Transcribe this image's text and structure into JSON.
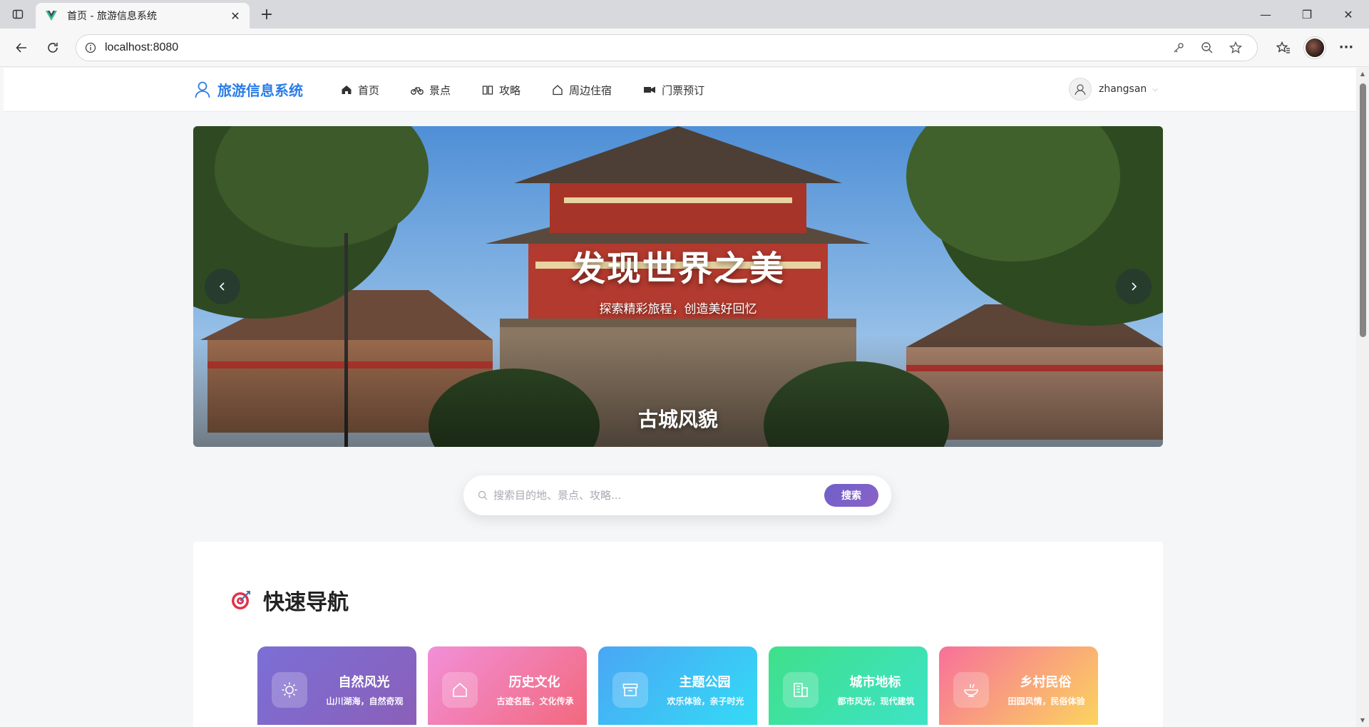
{
  "browser": {
    "tab_title": "首页 - 旅游信息系统",
    "url": "localhost:8080"
  },
  "header": {
    "brand": "旅游信息系统",
    "menu": [
      {
        "label": "首页",
        "icon": "home-icon"
      },
      {
        "label": "景点",
        "icon": "bicycle-icon"
      },
      {
        "label": "攻略",
        "icon": "book-icon"
      },
      {
        "label": "周边住宿",
        "icon": "house-icon"
      },
      {
        "label": "门票预订",
        "icon": "ticket-icon"
      }
    ],
    "username": "zhangsan"
  },
  "carousel": {
    "title": "发现世界之美",
    "subtitle": "探索精彩旅程，创造美好回忆",
    "caption": "古城风貌"
  },
  "search": {
    "placeholder": "搜索目的地、景点、攻略...",
    "button": "搜索"
  },
  "quick_nav": {
    "title": "快速导航",
    "items": [
      {
        "name": "自然风光",
        "desc": "山川湖海，自然奇观",
        "icon": "sun-icon",
        "colors": [
          "#7b6fd6",
          "#8a5fb8"
        ]
      },
      {
        "name": "历史文化",
        "desc": "古迹名胜，文化传承",
        "icon": "house-icon",
        "colors": [
          "#f28fd8",
          "#f2697d"
        ]
      },
      {
        "name": "主题公园",
        "desc": "欢乐体验，亲子时光",
        "icon": "box-icon",
        "colors": [
          "#4aa6f5",
          "#33dbf5"
        ]
      },
      {
        "name": "城市地标",
        "desc": "都市风光，现代建筑",
        "icon": "building-icon",
        "colors": [
          "#3fe08a",
          "#3ee3c6"
        ]
      },
      {
        "name": "乡村民俗",
        "desc": "田园风情，民俗体验",
        "icon": "bowl-icon",
        "colors": [
          "#f7709a",
          "#fbd45e"
        ]
      }
    ]
  }
}
